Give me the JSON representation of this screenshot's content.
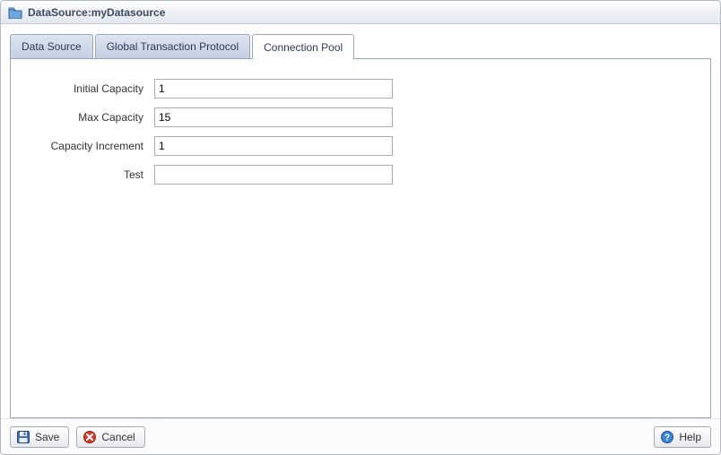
{
  "title": "DataSource:myDatasource",
  "tabs": [
    {
      "label": "Data Source",
      "active": false
    },
    {
      "label": "Global Transaction Protocol",
      "active": false
    },
    {
      "label": "Connection Pool",
      "active": true
    }
  ],
  "form": {
    "initial_capacity": {
      "label": "Initial Capacity",
      "value": "1"
    },
    "max_capacity": {
      "label": "Max Capacity",
      "value": "15"
    },
    "capacity_increment": {
      "label": "Capacity Increment",
      "value": "1"
    },
    "test": {
      "label": "Test",
      "value": ""
    }
  },
  "footer": {
    "save": "Save",
    "cancel": "Cancel",
    "help": "Help"
  }
}
